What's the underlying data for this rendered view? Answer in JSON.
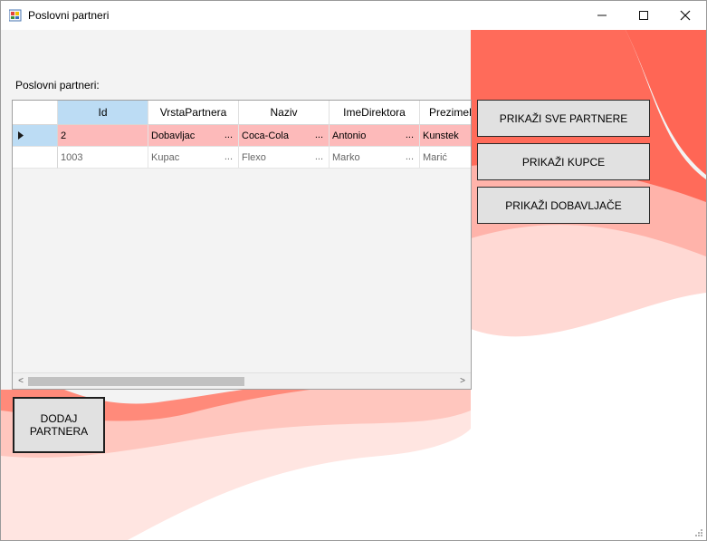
{
  "window": {
    "title": "Poslovni partneri",
    "controls": {
      "minimize": "—",
      "maximize": "☐",
      "close": "✕"
    }
  },
  "label": "Poslovni partneri:",
  "grid": {
    "columns": [
      "Id",
      "VrstaPartnera",
      "Naziv",
      "ImeDirektora",
      "PrezimeD"
    ],
    "rows": [
      {
        "selected": true,
        "cells": [
          "2",
          "Dobavljac",
          "Coca-Cola",
          "Antonio",
          "Kunstek"
        ]
      },
      {
        "selected": false,
        "cells": [
          "1003",
          "Kupac",
          "Flexo",
          "Marko",
          "Marić"
        ]
      }
    ],
    "ellipsis": "..."
  },
  "buttons": {
    "show_all": "PRIKAŽI SVE PARTNERE",
    "show_customers": "PRIKAŽI KUPCE",
    "show_suppliers": "PRIKAŽI DOBAVLJAČE",
    "add_partner_line1": "DODAJ",
    "add_partner_line2": "PARTNERA"
  },
  "colors": {
    "accent_red": "#ff6b5a",
    "selection_row": "#fdbaba",
    "selection_header": "#bcdcf4"
  },
  "icons": {
    "row_pointer": "▶",
    "scroll_left": "<",
    "scroll_right": ">"
  }
}
